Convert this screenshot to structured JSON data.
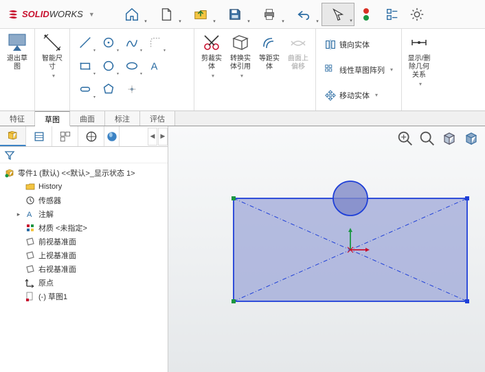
{
  "app": {
    "brand_prefix": "SOLID",
    "brand_suffix": "WORKS"
  },
  "ribbon": {
    "exit_sketch": "退出草\n图",
    "smart_dim": "智能尺\n寸",
    "trim": "剪裁实\n体",
    "convert": "转换实\n体引用",
    "offset": "等距实\n体",
    "surface_offset": "曲面上\n偏移",
    "mirror": "镜向实体",
    "linear_pattern": "线性草图阵列",
    "move": "移动实体",
    "display_rel": "显示/删\n除几何\n关系"
  },
  "tabs": [
    "特征",
    "草图",
    "曲面",
    "标注",
    "评估"
  ],
  "active_tab": "草图",
  "tree": {
    "root": "零件1 (默认) <<默认>_显示状态 1>",
    "items": [
      {
        "label": "History",
        "icon": "folder"
      },
      {
        "label": "传感器",
        "icon": "sensor"
      },
      {
        "label": "注解",
        "icon": "annotate",
        "expandable": true
      },
      {
        "label": "材质 <未指定>",
        "icon": "material"
      },
      {
        "label": "前视基准面",
        "icon": "plane"
      },
      {
        "label": "上视基准面",
        "icon": "plane"
      },
      {
        "label": "右视基准面",
        "icon": "plane"
      },
      {
        "label": "原点",
        "icon": "origin"
      },
      {
        "label": "(-) 草图1",
        "icon": "sketch"
      }
    ]
  },
  "colors": {
    "brand": "#c8102e",
    "sketch_blue": "#1e3fd8",
    "sel_face": "#9fa8d8"
  }
}
